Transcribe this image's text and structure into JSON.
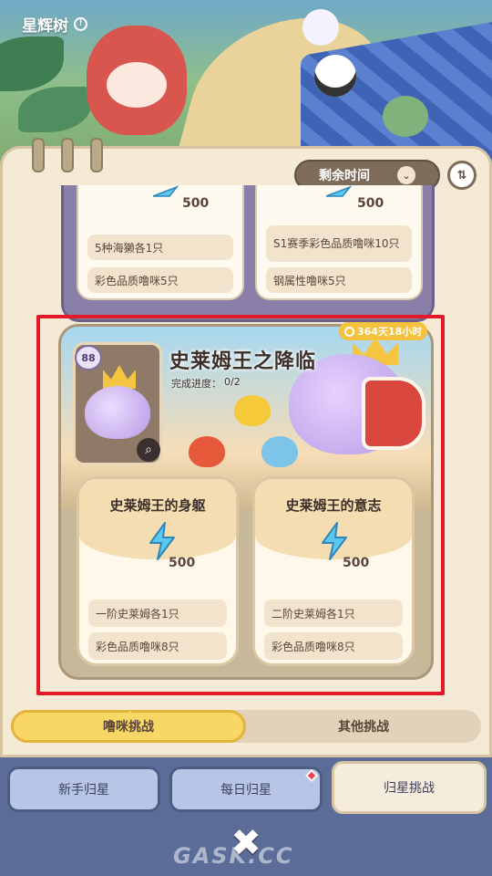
{
  "header": {
    "title": "星辉树"
  },
  "controls": {
    "sort_label": "剩余时间",
    "sort_chevron": "⌄",
    "order_icon": "⇅"
  },
  "previous_card": {
    "left": {
      "reward": "500",
      "reqs": [
        "5种海獭各1只",
        "彩色品质噜咪5只"
      ]
    },
    "right": {
      "reward": "500",
      "reqs": [
        "S1赛季彩色品质噜咪10只",
        "钢属性噜咪5只"
      ]
    }
  },
  "featured": {
    "timer": "364天18小时",
    "level": "88",
    "title": "史莱姆王之降临",
    "progress_label": "完成进度：",
    "progress_value": "0/2",
    "tasks": [
      {
        "name": "史莱姆王的身躯",
        "reward": "500",
        "reqs": [
          "一阶史莱姆各1只",
          "彩色品质噜咪8只"
        ]
      },
      {
        "name": "史莱姆王的意志",
        "reward": "500",
        "reqs": [
          "二阶史莱姆各1只",
          "彩色品质噜咪8只"
        ]
      }
    ]
  },
  "segment": {
    "active": "噜咪挑战",
    "other": "其他挑战"
  },
  "bottom_tabs": [
    "新手归星",
    "每日归星",
    "归星挑战"
  ],
  "close_symbol": "✖",
  "watermark": "GASK.CC",
  "colors": {
    "accent_yellow": "#f9d767",
    "highlight_red": "#e3192a",
    "bolt_blue": "#5ac8f0"
  }
}
